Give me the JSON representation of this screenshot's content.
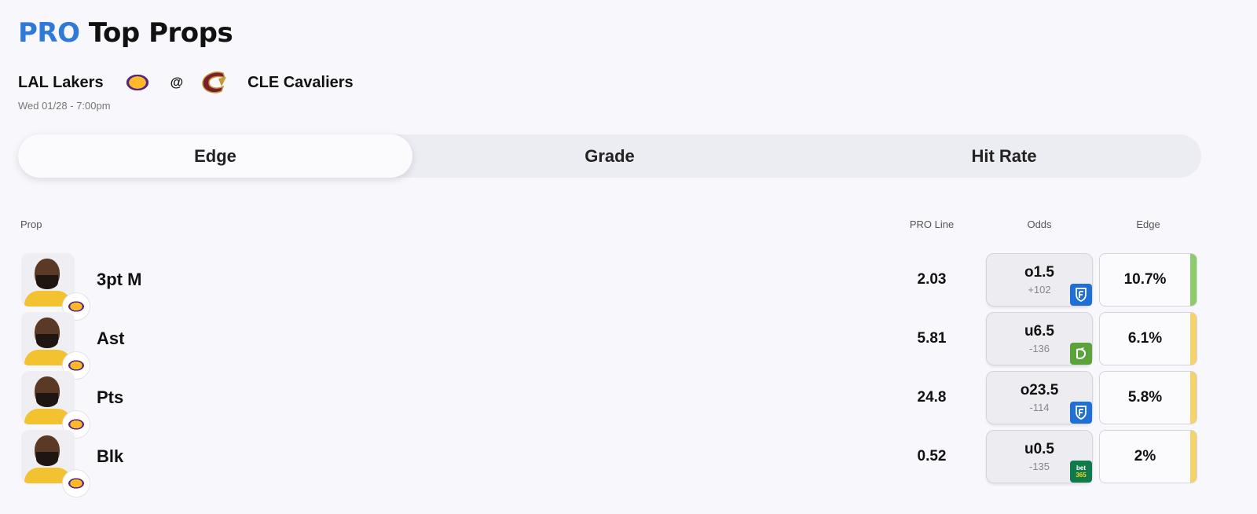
{
  "title": {
    "pro": "PRO",
    "rest": "Top Props"
  },
  "game": {
    "home_team": "LAL Lakers",
    "home_logo_text": "LAKERS",
    "separator": "@",
    "away_team": "CLE Cavaliers",
    "datetime": "Wed 01/28 - 7:00pm"
  },
  "tabs": [
    {
      "label": "Edge",
      "active": true
    },
    {
      "label": "Grade",
      "active": false
    },
    {
      "label": "Hit Rate",
      "active": false
    }
  ],
  "table": {
    "headers": {
      "prop": "Prop",
      "pro_line": "PRO Line",
      "odds": "Odds",
      "edge": "Edge"
    },
    "rows": [
      {
        "prop": "3pt M",
        "pro_line": "2.03",
        "odds_line": "o1.5",
        "odds_price": "+102",
        "book": "fanduel-icon",
        "edge": "10.7%",
        "edge_color": "#8dcc6a"
      },
      {
        "prop": "Ast",
        "pro_line": "5.81",
        "odds_line": "u6.5",
        "odds_price": "-136",
        "book": "draftkings-icon",
        "edge": "6.1%",
        "edge_color": "#f5d26a"
      },
      {
        "prop": "Pts",
        "pro_line": "24.8",
        "odds_line": "o23.5",
        "odds_price": "-114",
        "book": "fanduel-icon",
        "edge": "5.8%",
        "edge_color": "#f5d26a"
      },
      {
        "prop": "Blk",
        "pro_line": "0.52",
        "odds_line": "u0.5",
        "odds_price": "-135",
        "book": "bet365-icon",
        "edge": "2%",
        "edge_color": "#f5d26a"
      }
    ]
  },
  "book_labels": {
    "bet365_top": "bet",
    "bet365_bottom": "365"
  },
  "colors": {
    "accent": "#2f7ad9",
    "edge_green": "#8dcc6a",
    "edge_yellow": "#f5d26a",
    "cavs_wine": "#7a1f2b",
    "cavs_gold": "#c49a3c"
  }
}
